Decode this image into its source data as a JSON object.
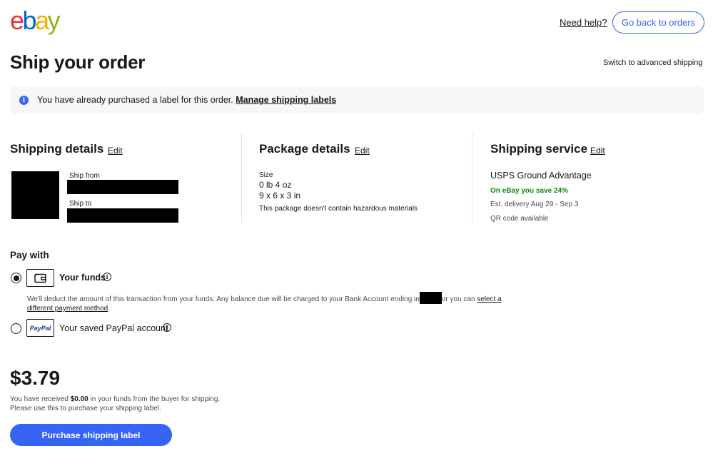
{
  "header": {
    "logo_letters": [
      "e",
      "b",
      "a",
      "y"
    ],
    "logo_colors": [
      "#e53238",
      "#0064d2",
      "#f5af02",
      "#86b817"
    ],
    "need_help": "Need help?",
    "go_back": "Go back to orders"
  },
  "page": {
    "title": "Ship your order",
    "switch_link": "Switch to advanced shipping"
  },
  "banner": {
    "icon": "info-icon",
    "text": "You have already purchased a label for this order. ",
    "link": "Manage shipping labels"
  },
  "shipping_details": {
    "title": "Shipping details",
    "edit": "Edit",
    "ship_from_label": "Ship from",
    "ship_to_label": "Ship to"
  },
  "package_details": {
    "title": "Package details",
    "edit": "Edit",
    "size_label": "Size",
    "weight": "0 lb 4 oz",
    "dimensions": "9 x 6 x 3 in",
    "note": "This package doesn't contain hazardous materials"
  },
  "shipping_service": {
    "title": "Shipping service",
    "edit": "Edit",
    "name": "USPS Ground Advantage",
    "savings": "On eBay you save 24%",
    "delivery": "Est. delivery Aug 29 - Sep 3",
    "qr": "QR code available"
  },
  "pay_with": {
    "title": "Pay with",
    "funds_label": "Your funds",
    "funds_selected": true,
    "funds_desc_1": "We'll deduct the amount of this transaction from your funds. Any balance due will be charged to your Bank Account ending in",
    "funds_desc_2": "or you can ",
    "funds_link": "select a different payment method",
    "funds_desc_end": ".",
    "paypal_label": "Your saved PayPal account",
    "paypal_logo_text": "PayPal"
  },
  "summary": {
    "price": "$3.79",
    "recv_1": "You have received ",
    "recv_amount": "$0.00",
    "recv_2": " in your funds from the buyer for shipping.",
    "recv_line2": "Please use this to purchase your shipping label.",
    "purchase_button": "Purchase shipping label"
  },
  "colors": {
    "accent": "#3665f3",
    "savings_green": "#0a8a0a"
  }
}
